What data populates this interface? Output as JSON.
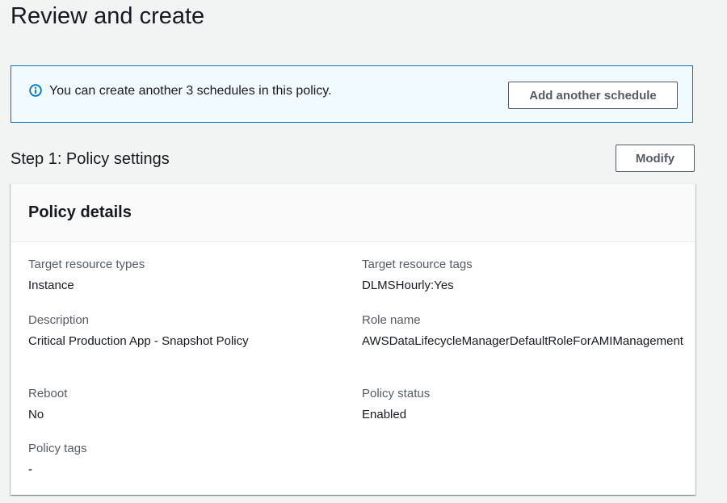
{
  "page": {
    "title": "Review and create"
  },
  "alert": {
    "message": "You can create another 3 schedules in this policy.",
    "icon": "info-icon",
    "button_label": "Add another schedule"
  },
  "step1": {
    "title": "Step 1: Policy settings",
    "modify_label": "Modify"
  },
  "policy_details": {
    "heading": "Policy details",
    "fields": [
      {
        "label": "Target resource types",
        "value": "Instance"
      },
      {
        "label": "Target resource tags",
        "value": "DLMSHourly:Yes"
      },
      {
        "label": "Description",
        "value": "Critical Production App - Snapshot Policy"
      },
      {
        "label": "Role name",
        "value": "AWSDataLifecycleManagerDefaultRoleForAMIManagement"
      },
      {
        "label": "Reboot",
        "value": "No"
      },
      {
        "label": "Policy status",
        "value": "Enabled"
      },
      {
        "label": "Policy tags",
        "value": "-"
      }
    ]
  },
  "colors": {
    "alert_border": "#0073bb",
    "alert_bg": "#f1faff",
    "page_bg": "#f2f3f3"
  }
}
